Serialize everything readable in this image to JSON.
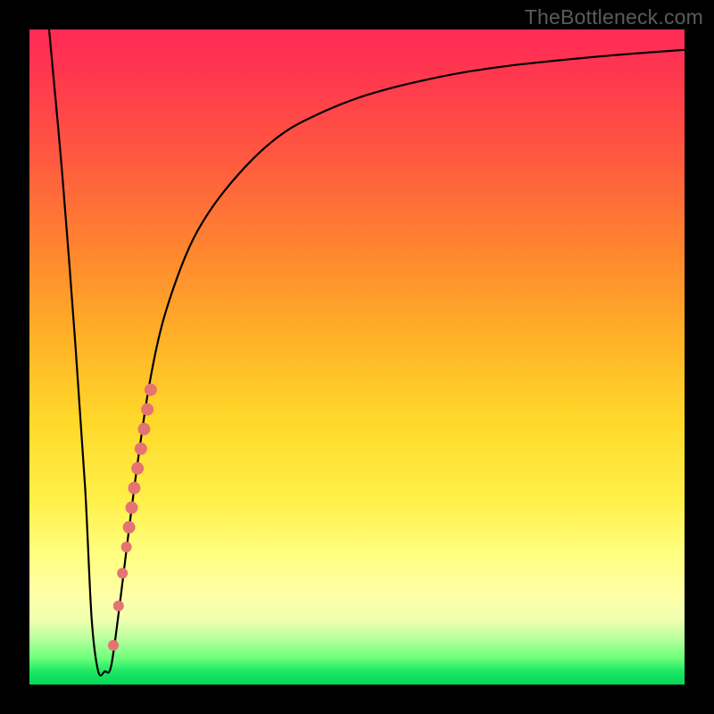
{
  "watermark": "TheBottleneck.com",
  "chart_data": {
    "type": "line",
    "title": "",
    "xlabel": "",
    "ylabel": "",
    "x_range": [
      0,
      100
    ],
    "y_range": [
      0,
      100
    ],
    "series": [
      {
        "name": "bottleneck-curve",
        "x": [
          3,
          5,
          7,
          8.5,
          9.5,
          10.5,
          11.5,
          12.5,
          14,
          16,
          18,
          20,
          22.5,
          25,
          28,
          32,
          36,
          40,
          45,
          50,
          55,
          60,
          66,
          72,
          78,
          85,
          92,
          100
        ],
        "y": [
          100,
          78,
          52,
          30,
          10,
          2,
          2,
          3,
          14,
          30,
          44,
          54,
          62,
          68,
          73,
          78,
          82,
          85,
          87.5,
          89.5,
          91,
          92.2,
          93.4,
          94.3,
          95,
          95.7,
          96.3,
          96.9
        ]
      }
    ],
    "markers": {
      "name": "highlight-dots",
      "color": "#e57373",
      "points": [
        {
          "x": 12.8,
          "y": 6,
          "r": 6
        },
        {
          "x": 13.6,
          "y": 12,
          "r": 6
        },
        {
          "x": 14.2,
          "y": 17,
          "r": 6
        },
        {
          "x": 14.8,
          "y": 21,
          "r": 6
        },
        {
          "x": 15.2,
          "y": 24,
          "r": 7
        },
        {
          "x": 15.6,
          "y": 27,
          "r": 7
        },
        {
          "x": 16.0,
          "y": 30,
          "r": 7
        },
        {
          "x": 16.5,
          "y": 33,
          "r": 7
        },
        {
          "x": 17.0,
          "y": 36,
          "r": 7
        },
        {
          "x": 17.5,
          "y": 39,
          "r": 7
        },
        {
          "x": 18.0,
          "y": 42,
          "r": 7
        },
        {
          "x": 18.5,
          "y": 45,
          "r": 7
        }
      ]
    },
    "gradient_stops": [
      {
        "pos": 0,
        "color": "#ff2a55"
      },
      {
        "pos": 50,
        "color": "#ffd92a"
      },
      {
        "pos": 85,
        "color": "#ffffa5"
      },
      {
        "pos": 100,
        "color": "#06d658"
      }
    ]
  }
}
